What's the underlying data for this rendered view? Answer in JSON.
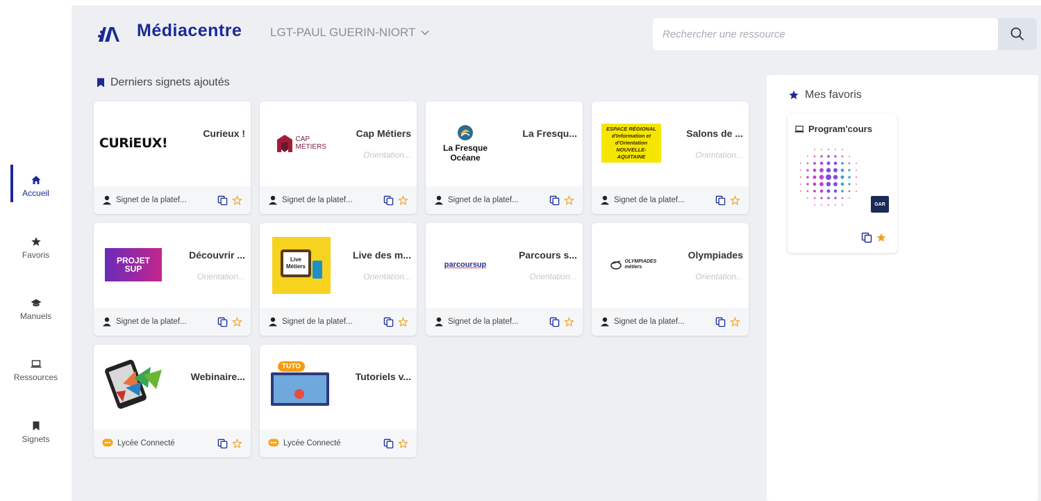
{
  "app": {
    "title": "Médiacentre",
    "school": "LGT-PAUL GUERIN-NIORT",
    "brand_color": "#1b2a97"
  },
  "search": {
    "placeholder": "Rechercher une ressource",
    "value": ""
  },
  "sidebar": {
    "items": [
      {
        "label": "Accueil",
        "icon": "home-icon",
        "active": true
      },
      {
        "label": "Favoris",
        "icon": "star-icon",
        "active": false
      },
      {
        "label": "Manuels",
        "icon": "graduation-cap-icon",
        "active": false
      },
      {
        "label": "Ressources",
        "icon": "laptop-icon",
        "active": false
      },
      {
        "label": "Signets",
        "icon": "bookmark-icon",
        "active": false
      }
    ]
  },
  "bookmarks": {
    "title": "Derniers signets ajoutés",
    "cards": [
      {
        "title": "Curieux !",
        "subtitle": "",
        "source": "Signet de la platef...",
        "thumb_text": "CURiEUX!"
      },
      {
        "title": "Cap Métiers",
        "subtitle": "Orientation...",
        "source": "Signet de la platef...",
        "thumb_text": "CAP MÉTIERS"
      },
      {
        "title": "La Fresqu...",
        "subtitle": "",
        "source": "Signet de la platef...",
        "thumb_text": "La Fresque Océane"
      },
      {
        "title": "Salons de ...",
        "subtitle": "Orientation...",
        "source": "Signet de la platef...",
        "thumb_text": "ESPACE RÉGIONAL d'Information et d'Orientation NOUVELLE-AQUITAINE"
      },
      {
        "title": "Découvrir ...",
        "subtitle": "Orientation...",
        "source": "Signet de la platef...",
        "thumb_text": "PROJET SUP"
      },
      {
        "title": "Live des m...",
        "subtitle": "Orientation...",
        "source": "Signet de la platef...",
        "thumb_text": "Live Métiers"
      },
      {
        "title": "Parcours s...",
        "subtitle": "Orientation...",
        "source": "Signet de la platef...",
        "thumb_text": "parcoursup"
      },
      {
        "title": "Olympiades",
        "subtitle": "Orientation...",
        "source": "Signet de la platef...",
        "thumb_text": "OLYMPIADES métiers"
      },
      {
        "title": "Webinaire...",
        "subtitle": "",
        "source": "Lycée Connecté",
        "thumb_text": ""
      },
      {
        "title": "Tutoriels v...",
        "subtitle": "",
        "source": "Lycée Connecté",
        "thumb_text": "TUTO"
      }
    ]
  },
  "favorites": {
    "title": "Mes favoris",
    "items": [
      {
        "title": "Program'cours",
        "badge": "GAR"
      }
    ]
  }
}
